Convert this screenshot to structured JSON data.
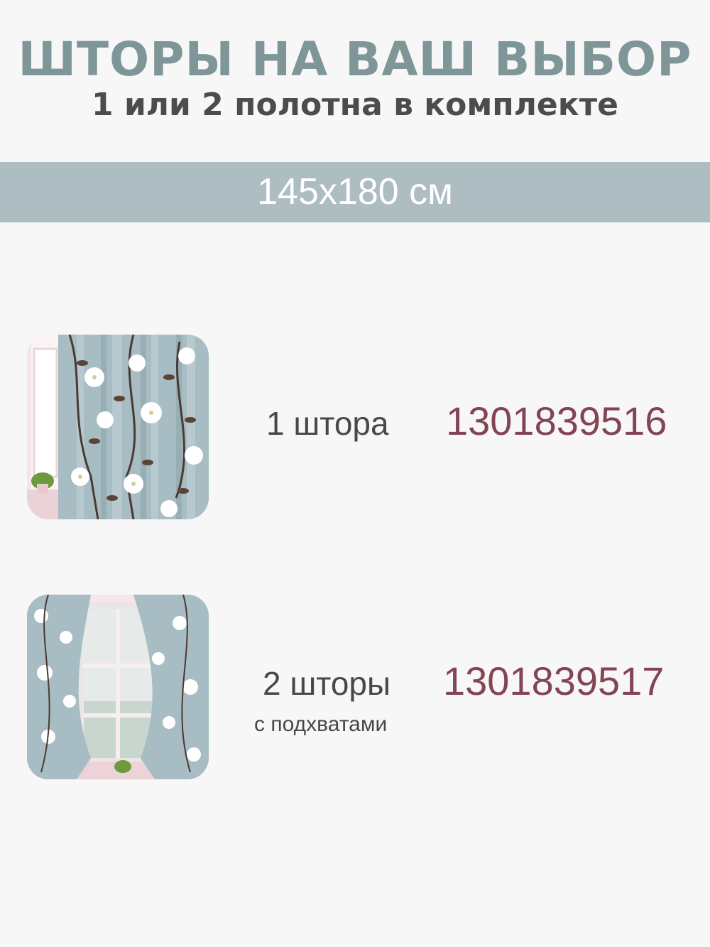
{
  "header": {
    "title": "ШТОРЫ НА ВАШ ВЫБОР",
    "subtitle": "1 или 2 полотна в комплекте"
  },
  "size_band": {
    "text": "145x180 см"
  },
  "options": [
    {
      "label": "1 штора",
      "article": "1301839516",
      "note": ""
    },
    {
      "label": "2 шторы",
      "article": "1301839517",
      "note": "с подхватами"
    }
  ],
  "colors": {
    "title": "#7f9699",
    "band": "#aebdc1",
    "article": "#834453",
    "text": "#484848",
    "fabric": "#a7bcc3"
  }
}
